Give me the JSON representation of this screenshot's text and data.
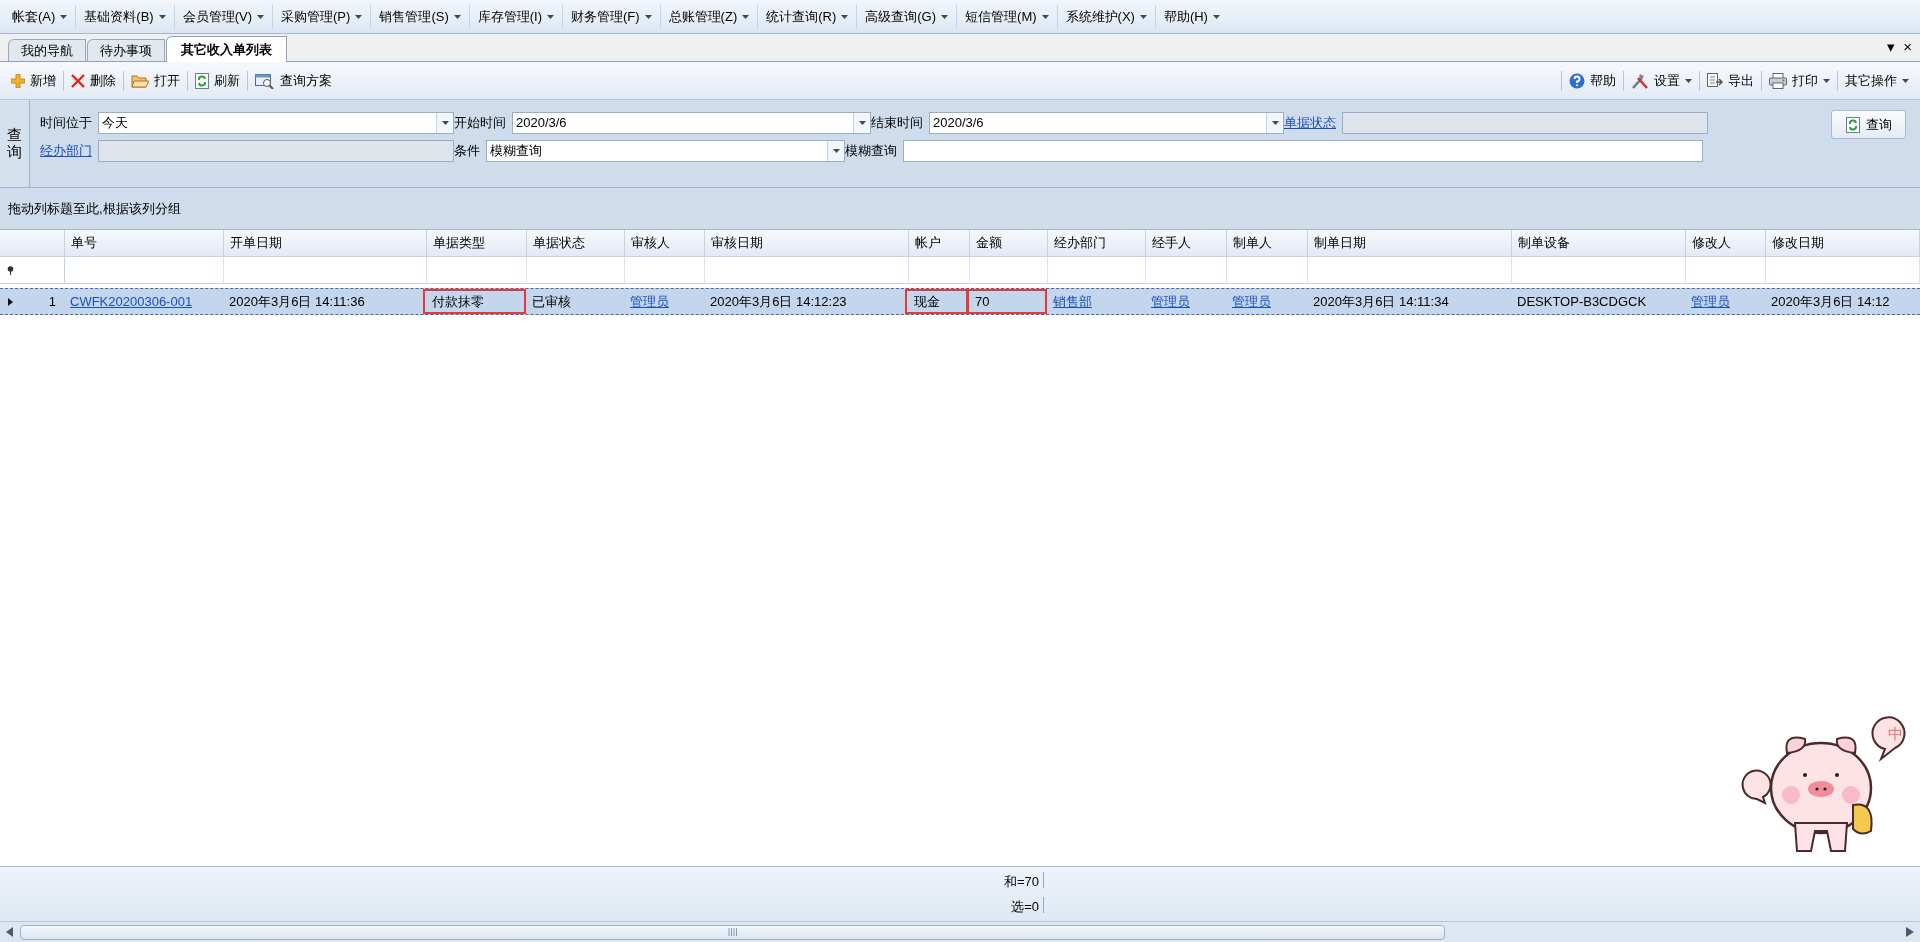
{
  "menu": [
    "帐套(A)",
    "基础资料(B)",
    "会员管理(V)",
    "采购管理(P)",
    "销售管理(S)",
    "库存管理(I)",
    "财务管理(F)",
    "总账管理(Z)",
    "统计查询(R)",
    "高级查询(G)",
    "短信管理(M)",
    "系统维护(X)",
    "帮助(H)"
  ],
  "tabs": [
    {
      "label": "我的导航",
      "selected": false
    },
    {
      "label": "待办事项",
      "selected": false
    },
    {
      "label": "其它收入单列表",
      "selected": true
    }
  ],
  "tab_controls": [
    "▾",
    "×"
  ],
  "toolbar_left": [
    {
      "kind": "add",
      "label": "新增"
    },
    {
      "kind": "delete",
      "label": "删除"
    },
    {
      "kind": "open",
      "label": "打开"
    },
    {
      "kind": "refresh",
      "label": "刷新"
    },
    {
      "kind": "scheme",
      "label": "查询方案"
    }
  ],
  "toolbar_right": [
    {
      "kind": "help",
      "label": "帮助",
      "dropdown": false
    },
    {
      "kind": "settings",
      "label": "设置",
      "dropdown": true
    },
    {
      "kind": "export",
      "label": "导出",
      "dropdown": false
    },
    {
      "kind": "print",
      "label": "打印",
      "dropdown": true
    },
    {
      "kind": "more",
      "label": "其它操作",
      "dropdown": true
    }
  ],
  "query": {
    "title": "查询",
    "time_range": {
      "label": "时间位于",
      "value": "今天"
    },
    "start_time": {
      "label": "开始时间",
      "value": "2020/3/6"
    },
    "end_time": {
      "label": "结束时间",
      "value": "2020/3/6"
    },
    "doc_status": {
      "label": "单据状态"
    },
    "department": {
      "label": "经办部门"
    },
    "condition": {
      "label": "条件",
      "value": "模糊查询"
    },
    "fuzzy": {
      "label": "模糊查询"
    },
    "button": "查询"
  },
  "group_hint": "拖动列标题至此,根据该列分组",
  "table": {
    "columns": [
      "单号",
      "开单日期",
      "单据类型",
      "单据状态",
      "审核人",
      "审核日期",
      "帐户",
      "金额",
      "经办部门",
      "经手人",
      "制单人",
      "制单日期",
      "制单设备",
      "修改人",
      "修改日期"
    ],
    "rows": [
      {
        "number": "1",
        "selected": true,
        "cells": [
          {
            "text": "CWFK20200306-001",
            "link": true,
            "highlighted": false
          },
          {
            "text": "2020年3月6日 14:11:36",
            "link": false,
            "highlighted": false
          },
          {
            "text": "付款抹零",
            "link": false,
            "highlighted": true
          },
          {
            "text": "已审核",
            "link": false,
            "highlighted": false
          },
          {
            "text": "管理员",
            "link": true,
            "highlighted": false
          },
          {
            "text": "2020年3月6日 14:12:23",
            "link": false,
            "highlighted": false
          },
          {
            "text": "现金",
            "link": false,
            "highlighted": true
          },
          {
            "text": "70",
            "link": false,
            "highlighted": true
          },
          {
            "text": "销售部",
            "link": true,
            "highlighted": false
          },
          {
            "text": "管理员",
            "link": true,
            "highlighted": false
          },
          {
            "text": "管理员",
            "link": true,
            "highlighted": false
          },
          {
            "text": "2020年3月6日 14:11:34",
            "link": false,
            "highlighted": false
          },
          {
            "text": "DESKTOP-B3CDGCK",
            "link": false,
            "highlighted": false
          },
          {
            "text": "管理员",
            "link": true,
            "highlighted": false
          },
          {
            "text": "2020年3月6日 14:12",
            "link": false,
            "highlighted": false
          }
        ]
      }
    ]
  },
  "summary": [
    "和=70",
    "选=0"
  ],
  "mascot": {
    "bubble_text": "中"
  }
}
